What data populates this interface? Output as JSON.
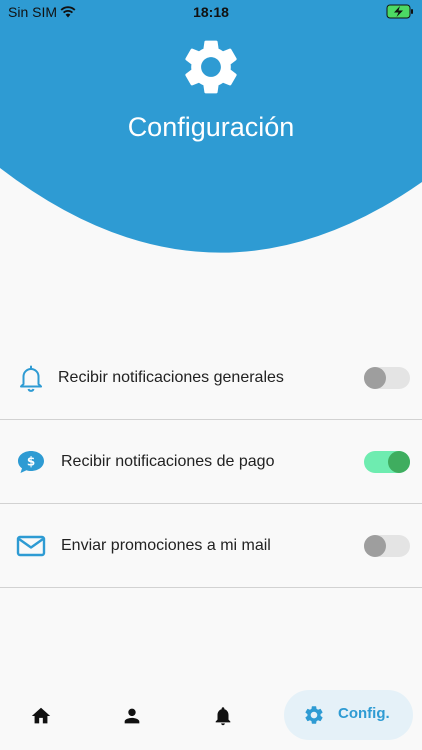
{
  "status_bar": {
    "carrier": "Sin SIM",
    "time": "18:18",
    "wifi_icon": "wifi-icon",
    "battery_icon": "battery-charging-icon"
  },
  "header": {
    "title": "Configuración",
    "icon": "gear-icon",
    "background_color": "#2e9bd3"
  },
  "settings": [
    {
      "icon": "bell-icon",
      "label": "Recibir notificaciones generales",
      "enabled": false
    },
    {
      "icon": "dollar-chat-icon",
      "label": "Recibir notificaciones de pago",
      "enabled": true
    },
    {
      "icon": "mail-icon",
      "label": "Enviar promociones a mi mail",
      "enabled": false
    }
  ],
  "bottom_nav": {
    "items": [
      {
        "icon": "home-icon"
      },
      {
        "icon": "person-icon"
      },
      {
        "icon": "bell-icon"
      },
      {
        "icon": "gear-icon",
        "label": "Config.",
        "active": true
      }
    ]
  },
  "colors": {
    "accent": "#2e9bd3",
    "toggle_on_track": "#6eecb0",
    "toggle_on_knob": "#3fad5f",
    "toggle_off_track": "#e4e4e4",
    "toggle_off_knob": "#9e9e9e"
  }
}
